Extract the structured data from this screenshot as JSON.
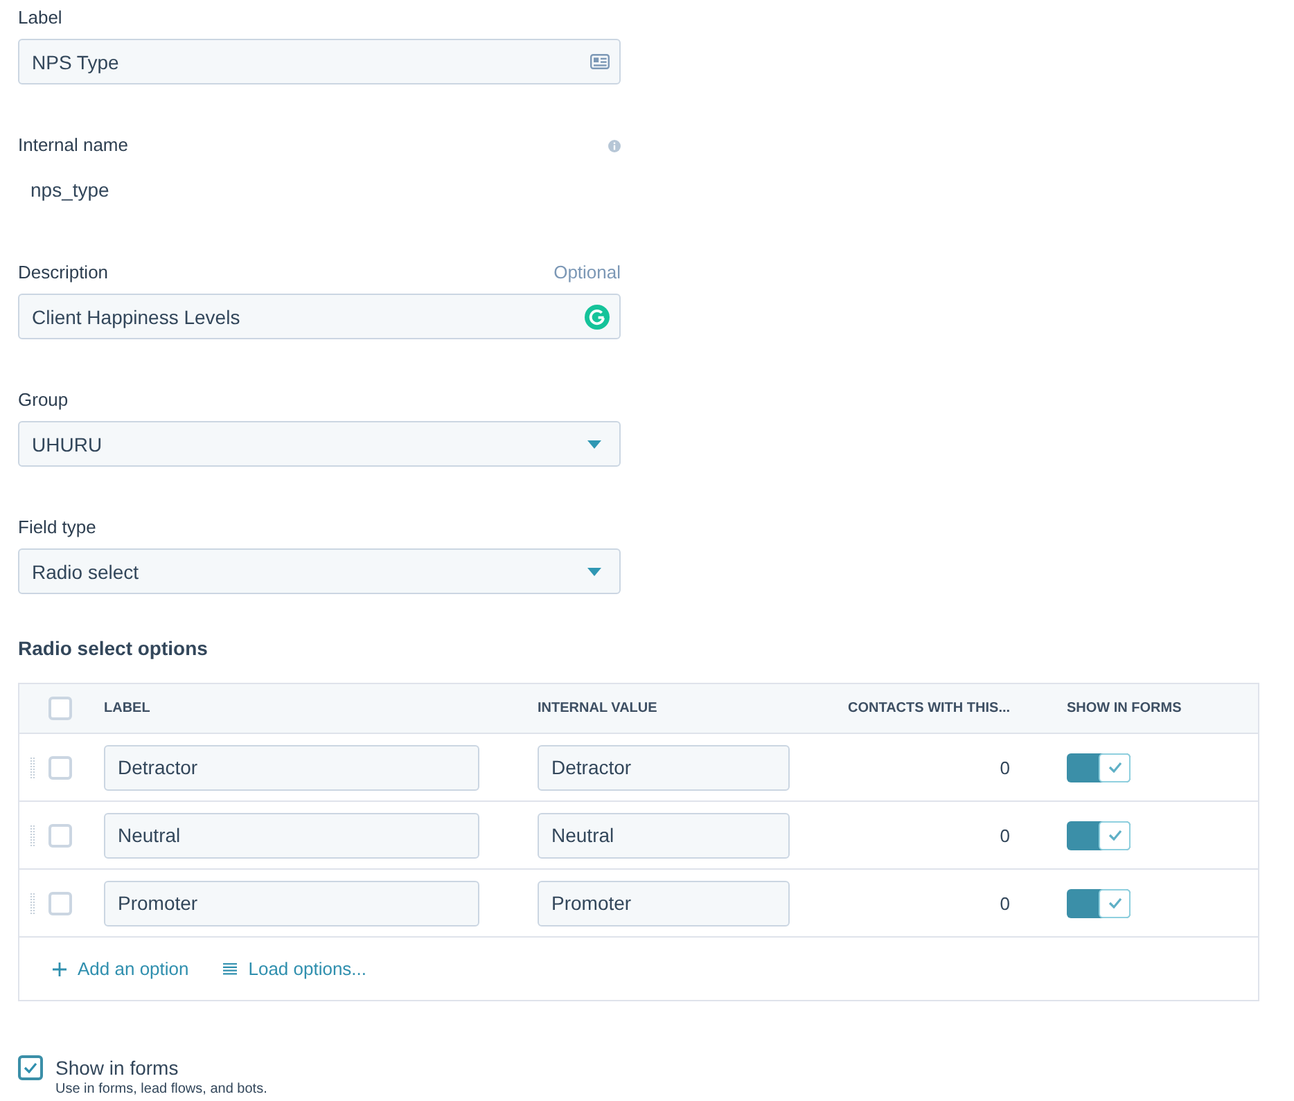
{
  "label_field": {
    "label": "Label",
    "value": "NPS Type"
  },
  "internal_name": {
    "label": "Internal name",
    "value": "nps_type"
  },
  "description": {
    "label": "Description",
    "hint": "Optional",
    "value": "Client Happiness Levels"
  },
  "group": {
    "label": "Group",
    "value": "UHURU"
  },
  "field_type": {
    "label": "Field type",
    "value": "Radio select"
  },
  "options": {
    "title": "Radio select options",
    "select_all": {
      "checked": false
    },
    "columns": [
      "LABEL",
      "INTERNAL VALUE",
      "CONTACTS WITH THIS...",
      "SHOW IN FORMS"
    ],
    "rows": [
      {
        "checked": false,
        "label": "Detractor",
        "internal_value": "Detractor",
        "contacts": "0",
        "show_in_forms": true
      },
      {
        "checked": false,
        "label": "Neutral",
        "internal_value": "Neutral",
        "contacts": "0",
        "show_in_forms": true
      },
      {
        "checked": false,
        "label": "Promoter",
        "internal_value": "Promoter",
        "contacts": "0",
        "show_in_forms": true
      }
    ],
    "actions": [
      {
        "kind": "add",
        "label": "Add an option"
      },
      {
        "kind": "load",
        "label": "Load options..."
      }
    ]
  },
  "show_in_forms": {
    "checked": true,
    "label": "Show in forms",
    "help": "Use in forms, lead flows, and bots."
  }
}
